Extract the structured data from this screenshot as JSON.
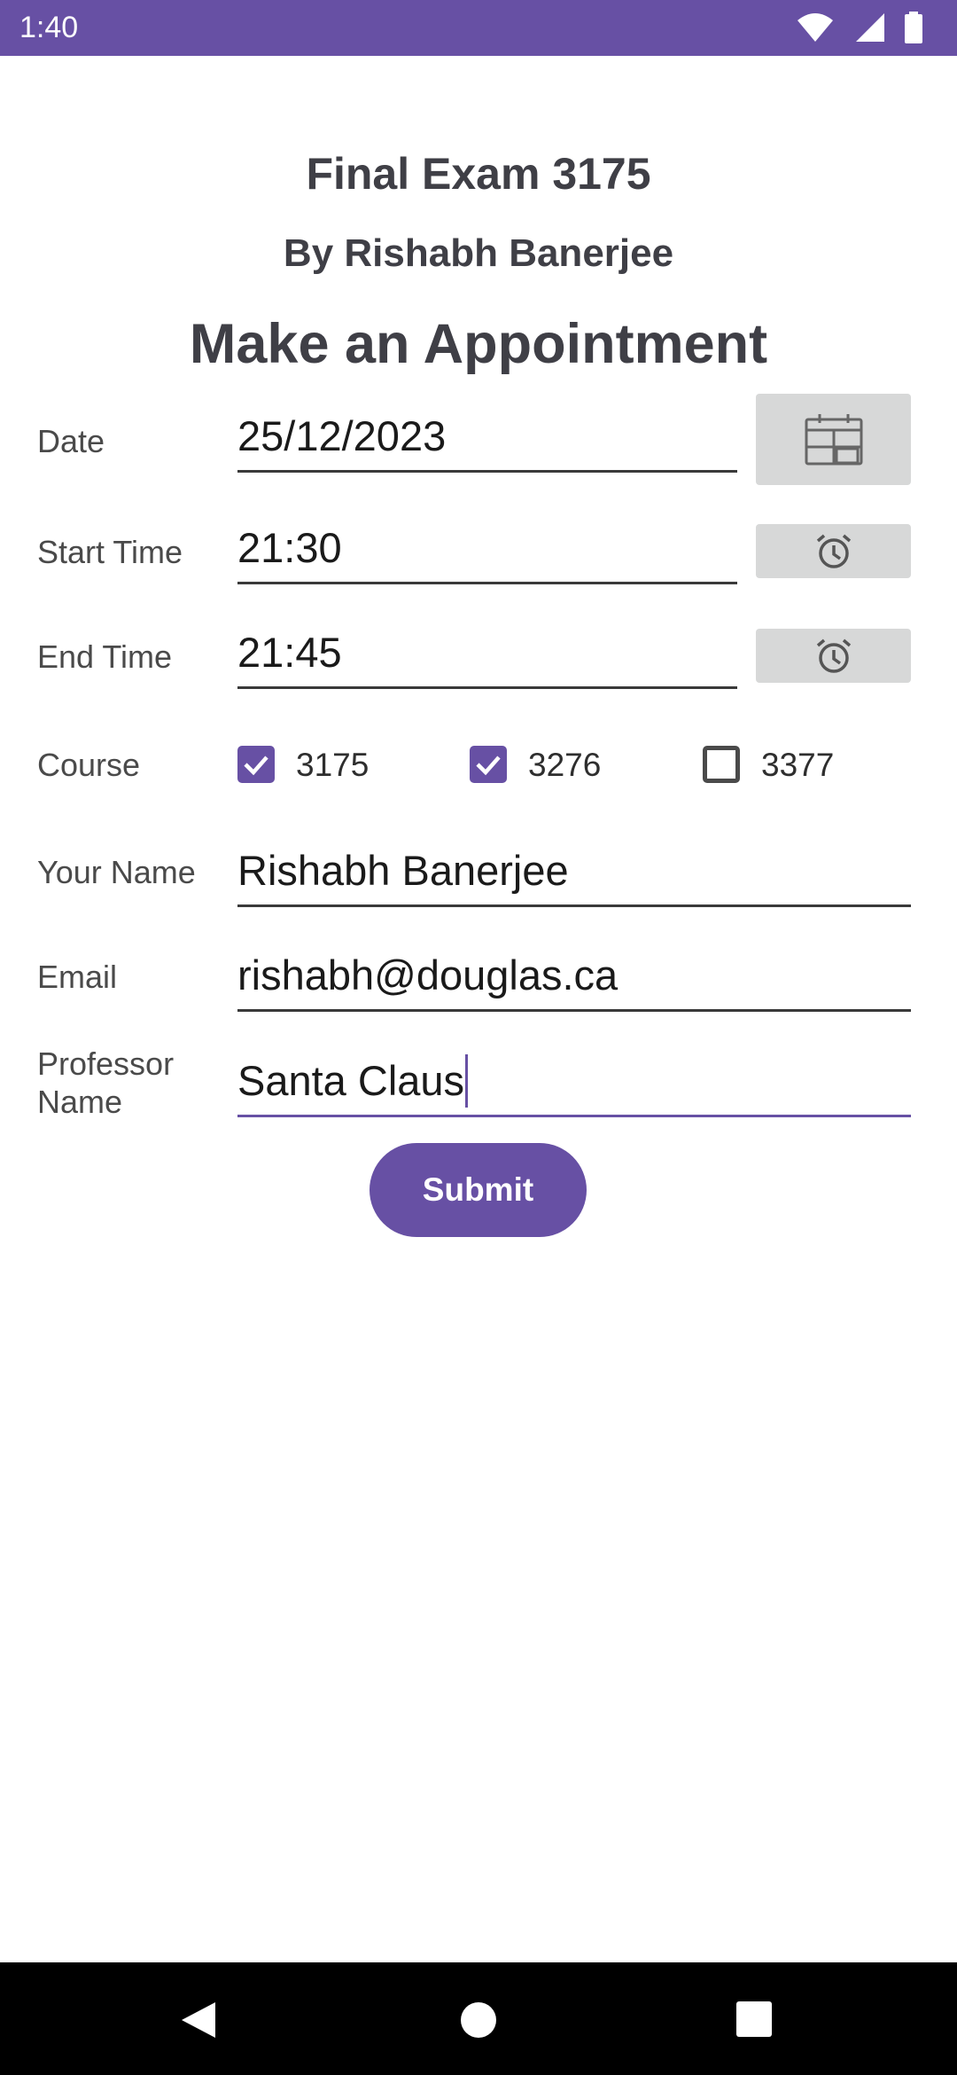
{
  "status_bar": {
    "time": "1:40"
  },
  "header": {
    "title": "Final Exam 3175",
    "author": "By Rishabh Banerjee",
    "subtitle": "Make an Appointment"
  },
  "form": {
    "date": {
      "label": "Date",
      "value": "25/12/2023",
      "button_icon": "calendar-icon"
    },
    "start_time": {
      "label": "Start Time",
      "value": "21:30",
      "button_icon": "alarm-clock-icon"
    },
    "end_time": {
      "label": "End Time",
      "value": "21:45",
      "button_icon": "alarm-clock-icon"
    },
    "course": {
      "label": "Course",
      "options": [
        {
          "label": "3175",
          "checked": true
        },
        {
          "label": "3276",
          "checked": true
        },
        {
          "label": "3377",
          "checked": false
        }
      ]
    },
    "your_name": {
      "label": "Your Name",
      "value": "Rishabh Banerjee"
    },
    "email": {
      "label": "Email",
      "value": "rishabh@douglas.ca"
    },
    "professor_name": {
      "label_line1": "Professor",
      "label_line2": "Name",
      "value": "Santa Claus"
    },
    "submit_label": "Submit"
  },
  "colors": {
    "accent": "#6750A4",
    "button_gray": "#d7d8d8",
    "title_text": "#3f3f46"
  },
  "nav_bar": {
    "icons": [
      "back-icon",
      "home-icon",
      "recents-icon"
    ]
  }
}
